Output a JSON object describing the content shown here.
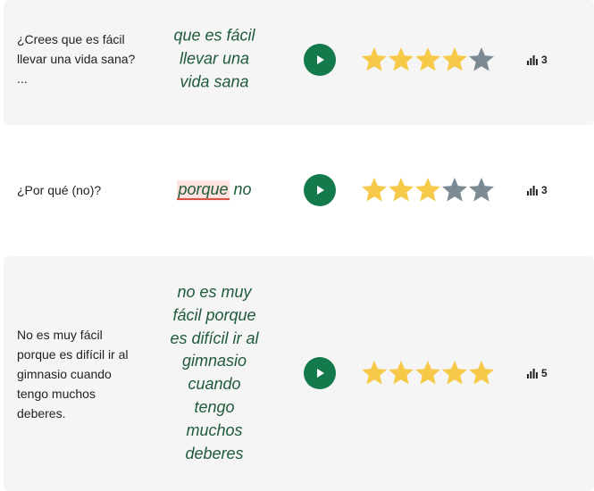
{
  "colors": {
    "row_shaded": "#f5f5f5",
    "answer_text": "#1f5a3a",
    "play_button": "#137a4b",
    "star_filled": "#f7c948",
    "star_empty": "#7c8a93",
    "highlight_bg": "#fde2e0",
    "highlight_underline": "#d84a3a"
  },
  "rows": [
    {
      "question": "¿Crees que es fácil llevar una vida sana? ...",
      "answer_lines": [
        "que es fácil",
        "llevar una",
        "vida sana"
      ],
      "rating": 4,
      "rating_max": 5,
      "count": "3",
      "play_icon": "play-icon",
      "count_icon": "bar-chart-icon"
    },
    {
      "question": "¿Por qué (no)?",
      "answer_highlight": "porque",
      "answer_rest": "no",
      "rating": 3,
      "rating_max": 5,
      "count": "3",
      "play_icon": "play-icon",
      "count_icon": "bar-chart-icon"
    },
    {
      "question": "No es muy fácil porque es difícil ir al gimnasio cuando tengo muchos deberes.",
      "answer_lines": [
        "no es muy",
        "fácil porque",
        "es difícil ir al",
        "gimnasio",
        "cuando",
        "tengo",
        "muchos",
        "deberes"
      ],
      "rating": 5,
      "rating_max": 5,
      "count": "5",
      "play_icon": "play-icon",
      "count_icon": "bar-chart-icon"
    }
  ]
}
